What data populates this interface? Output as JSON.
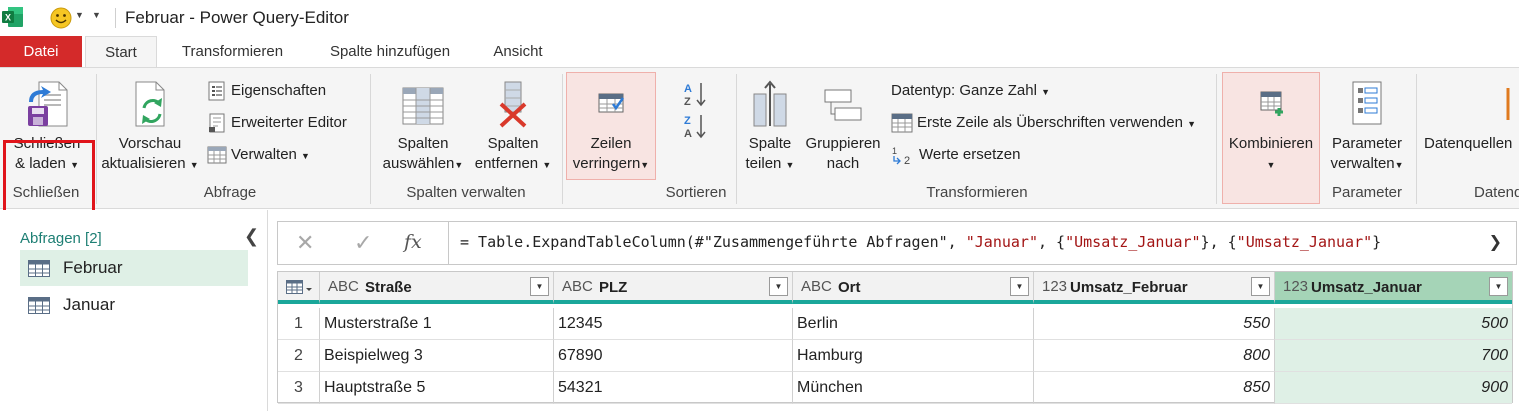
{
  "window": {
    "title": "Februar - Power Query-Editor"
  },
  "tabs": [
    "Datei",
    "Start",
    "Transformieren",
    "Spalte hinzufügen",
    "Ansicht"
  ],
  "ribbon": {
    "close": {
      "btn1": "Schließen",
      "btn2": "& laden",
      "group": "Schließen"
    },
    "query": {
      "refresh1": "Vorschau",
      "refresh2": "aktualisieren",
      "properties": "Eigenschaften",
      "advanced_editor": "Erweiterter Editor",
      "manage": "Verwalten",
      "group": "Abfrage"
    },
    "columns": {
      "choose1": "Spalten",
      "choose2": "auswählen",
      "remove1": "Spalten",
      "remove2": "entfernen",
      "group": "Spalten verwalten"
    },
    "rows": {
      "reduce1": "Zeilen",
      "reduce2": "verringern"
    },
    "sort": {
      "group": "Sortieren"
    },
    "transform": {
      "split1": "Spalte",
      "split2": "teilen",
      "group1": "Gruppieren",
      "group2": "nach",
      "datatype": "Datentyp: Ganze Zahl",
      "first_row": "Erste Zeile als Überschriften verwenden",
      "replace": "Werte ersetzen",
      "group": "Transformieren"
    },
    "combine": {
      "label": "Kombinieren"
    },
    "parameters": {
      "label1": "Parameter",
      "label2": "verwalten",
      "group": "Parameter"
    },
    "datasources": {
      "label": "Datenquellen",
      "group": "Datenq"
    }
  },
  "queries": {
    "header": "Abfragen [2]",
    "items": [
      "Februar",
      "Januar"
    ]
  },
  "formula": {
    "p1": "= Table.ExpandTableColumn(#\"Zusammengeführte Abfragen\", ",
    "s1": "\"Januar\"",
    "p2": ", {",
    "s2": "\"Umsatz_Januar\"",
    "p3": "}, {",
    "s3": "\"Umsatz_Januar\"",
    "p4": "}"
  },
  "table": {
    "columns": [
      {
        "type": "ABC",
        "name": "Straße"
      },
      {
        "type": "ABC",
        "name": "PLZ"
      },
      {
        "type": "ABC",
        "name": "Ort"
      },
      {
        "type": "123",
        "name": "Umsatz_Februar"
      },
      {
        "type": "123",
        "name": "Umsatz_Januar"
      }
    ],
    "rows": [
      {
        "n": "1",
        "c": [
          "Musterstraße 1",
          "12345",
          "Berlin",
          "550",
          "500"
        ]
      },
      {
        "n": "2",
        "c": [
          "Beispielweg 3",
          "67890",
          "Hamburg",
          "800",
          "700"
        ]
      },
      {
        "n": "3",
        "c": [
          "Hauptstraße 5",
          "54321",
          "München",
          "850",
          "900"
        ]
      }
    ]
  }
}
